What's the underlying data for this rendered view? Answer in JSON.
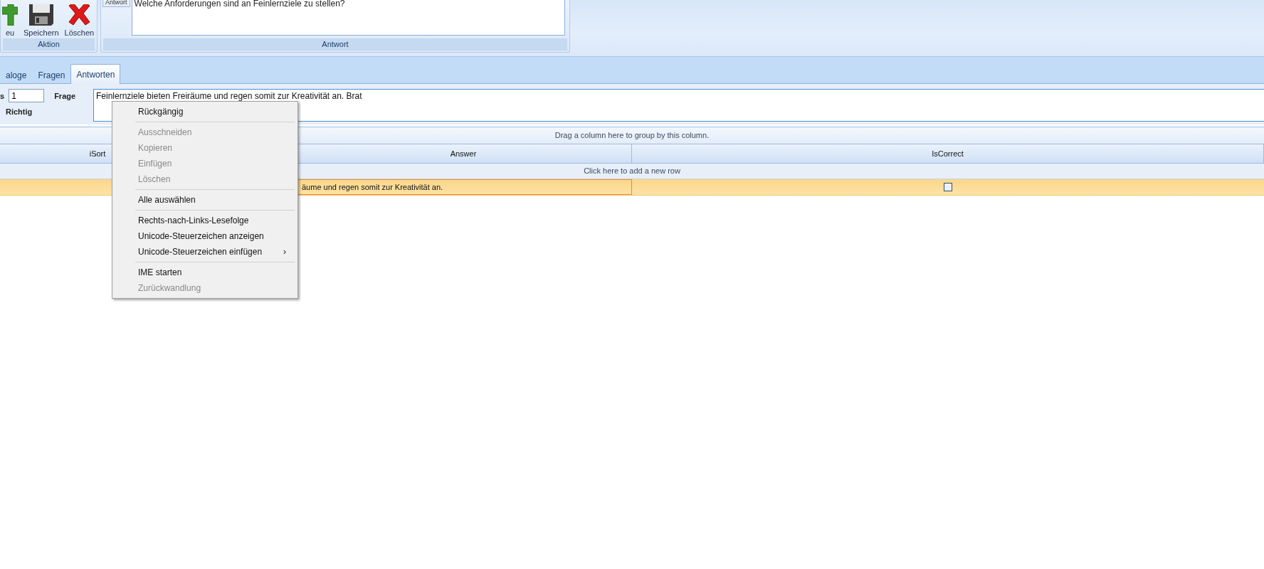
{
  "ribbon": {
    "action_group": {
      "label": "Aktion",
      "buttons": [
        {
          "label": "eu",
          "kind": "add"
        },
        {
          "label": "Speichern",
          "kind": "save"
        },
        {
          "label": "Löschen",
          "kind": "delete"
        }
      ]
    },
    "answer_group": {
      "label": "Antwort",
      "side_button": "Antwort",
      "text": "Welche Anforderungen sind an Feinlernziele zu stellen?"
    }
  },
  "tabs": [
    {
      "label": "aloge",
      "selected": false
    },
    {
      "label": "Fragen",
      "selected": false
    },
    {
      "label": "Antworten",
      "selected": true
    }
  ],
  "form": {
    "sort_label": "s",
    "sort_value": "1",
    "question_label": "Frage",
    "question_value": "Feinlernziele bieten Freiräume und regen somit zur Kreativität an. Brat",
    "correct_label": "Richtig"
  },
  "grid": {
    "group_hint": "Drag a column here to group by this column.",
    "columns": [
      "iSort",
      "Answer",
      "IsCorrect"
    ],
    "new_row_hint": "Click here to add a new row",
    "rows": [
      {
        "answer": "äume und regen somit zur Kreativität an.",
        "is_correct": false,
        "selected": true
      }
    ]
  },
  "context_menu": {
    "items": [
      {
        "kind": "item",
        "label": "Rückgängig",
        "disabled": false
      },
      {
        "kind": "separator"
      },
      {
        "kind": "item",
        "label": "Ausschneiden",
        "disabled": true
      },
      {
        "kind": "item",
        "label": "Kopieren",
        "disabled": true
      },
      {
        "kind": "item",
        "label": "Einfügen",
        "disabled": true
      },
      {
        "kind": "item",
        "label": "Löschen",
        "disabled": true
      },
      {
        "kind": "separator"
      },
      {
        "kind": "item",
        "label": "Alle auswählen",
        "disabled": false
      },
      {
        "kind": "separator"
      },
      {
        "kind": "item",
        "label": "Rechts-nach-Links-Lesefolge",
        "disabled": false
      },
      {
        "kind": "item",
        "label": "Unicode-Steuerzeichen anzeigen",
        "disabled": false
      },
      {
        "kind": "item",
        "label": "Unicode-Steuerzeichen einfügen",
        "disabled": false,
        "arrow": "›"
      },
      {
        "kind": "separator"
      },
      {
        "kind": "item",
        "label": "IME starten",
        "disabled": false
      },
      {
        "kind": "item",
        "label": "Zurückwandlung",
        "disabled": true
      }
    ]
  }
}
